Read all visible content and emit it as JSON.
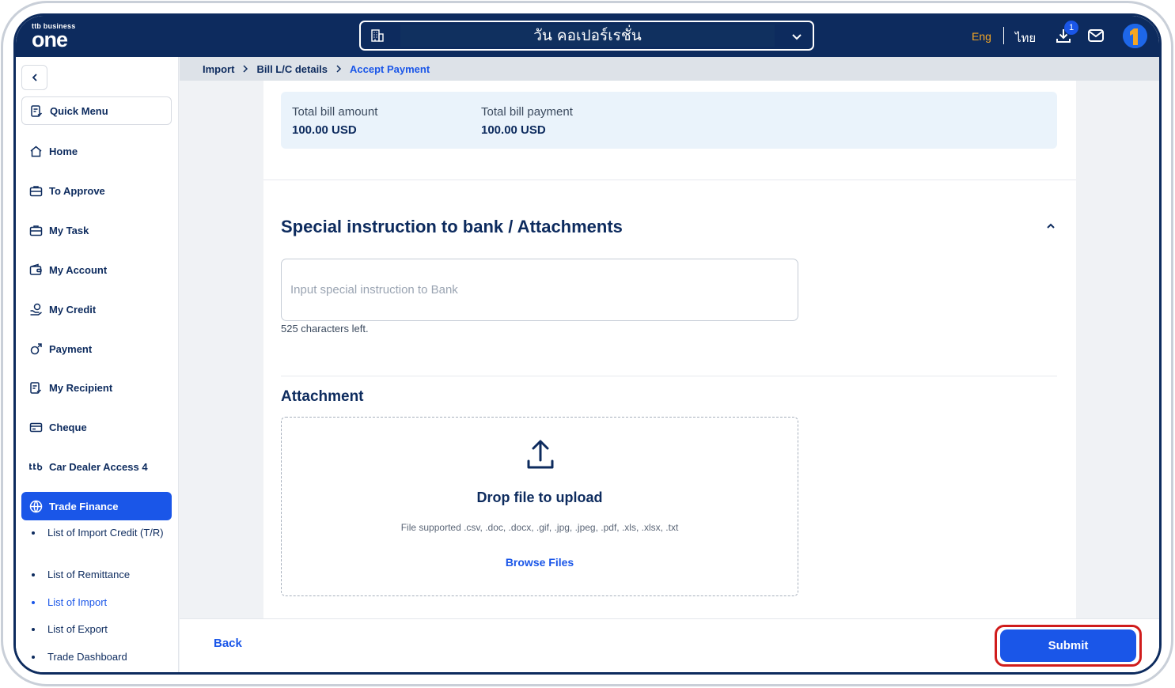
{
  "app": {
    "logo_small": "business",
    "logo_ttb": "ttb",
    "logo_big": "one"
  },
  "header": {
    "company_name": "วัน คอเปอร์เรชั่น",
    "lang_eng": "Eng",
    "lang_thai": "ไทย",
    "download_count": "1"
  },
  "sidebar": {
    "items": [
      {
        "label": "Quick Menu",
        "icon": "quick-menu-icon"
      },
      {
        "label": "Home",
        "icon": "home-icon"
      },
      {
        "label": "To Approve",
        "icon": "briefcase-icon"
      },
      {
        "label": "My Task",
        "icon": "briefcase-icon"
      },
      {
        "label": "My Account",
        "icon": "wallet-icon"
      },
      {
        "label": "My Credit",
        "icon": "credit-icon"
      },
      {
        "label": "Payment",
        "icon": "payment-icon"
      },
      {
        "label": "My Recipient",
        "icon": "recipient-icon"
      },
      {
        "label": "Cheque",
        "icon": "cheque-icon"
      },
      {
        "label": "Car Dealer Access 4",
        "icon": "ttb-icon"
      },
      {
        "label": "Trade Finance",
        "icon": "globe-icon"
      }
    ],
    "sub_items": [
      {
        "label": "List of Import Credit (T/R)"
      },
      {
        "label": "List of Remittance"
      },
      {
        "label": "List of Import"
      },
      {
        "label": "List of Export"
      },
      {
        "label": "Trade Dashboard"
      }
    ]
  },
  "breadcrumb": {
    "items": [
      "Import",
      "Bill L/C details",
      "Accept Payment"
    ]
  },
  "summary": {
    "total_bill_amount_label": "Total bill amount",
    "total_bill_amount_value": "100.00 USD",
    "total_bill_payment_label": "Total bill payment",
    "total_bill_payment_value": "100.00 USD"
  },
  "instruction": {
    "section_title": "Special instruction to bank / Attachments",
    "placeholder": "Input special instruction to Bank",
    "value": "",
    "chars_left": "525 characters left."
  },
  "attachment": {
    "title": "Attachment",
    "drop_text": "Drop file to upload",
    "supported": "File supported .csv, .doc, .docx, .gif, .jpg, .jpeg, .pdf, .xls, .xlsx, .txt",
    "browse_label": "Browse Files"
  },
  "footer": {
    "back_label": "Back",
    "submit_label": "Submit"
  },
  "colors": {
    "navy": "#0d2b5e",
    "primary": "#1a56e8",
    "accent_orange": "#f5a623",
    "highlight_red": "#d01c1c"
  }
}
